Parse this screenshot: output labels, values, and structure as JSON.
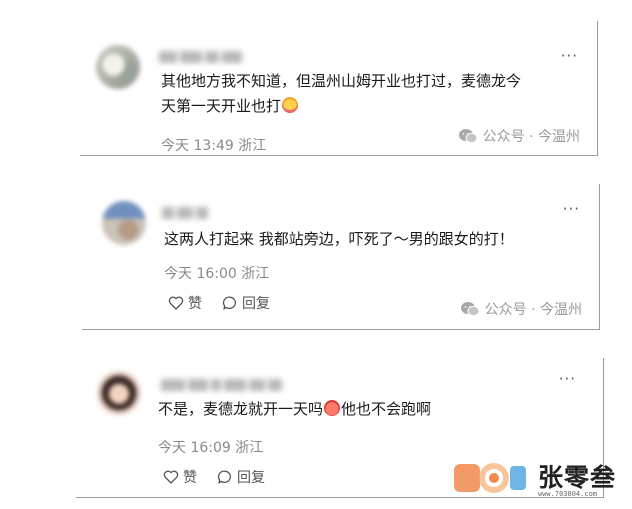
{
  "comments": [
    {
      "text_line1": "其他地方我不知道，但温州山姆开业也打过，麦德龙今",
      "text_line2": "天第一天开业也打",
      "emoji": "crying-face",
      "time": "今天 13:49",
      "location": "浙江",
      "source": "公众号 · 今温州",
      "more": "···"
    },
    {
      "text": "这两人打起来 我都站旁边，吓死了～男的跟女的打！",
      "time": "今天 16:00",
      "location": "浙江",
      "like_label": "赞",
      "reply_label": "回复",
      "source": "公众号 · 今温州",
      "more": "···"
    },
    {
      "text_before": "不是，麦德龙就开一天吗",
      "emoji": "angry-face",
      "text_after": "他也不会跑啊",
      "time": "今天 16:09",
      "location": "浙江",
      "like_label": "赞",
      "reply_label": "回复",
      "more": "···"
    }
  ],
  "watermark": {
    "text": "张零叁",
    "url": "www.703804.com"
  },
  "colors": {
    "text": "#1a1a1a",
    "meta": "#8a8a8a",
    "card_border": "#9a9a9a",
    "watermark_orange": "#f08a4b",
    "watermark_blue": "#4aa3e0"
  }
}
